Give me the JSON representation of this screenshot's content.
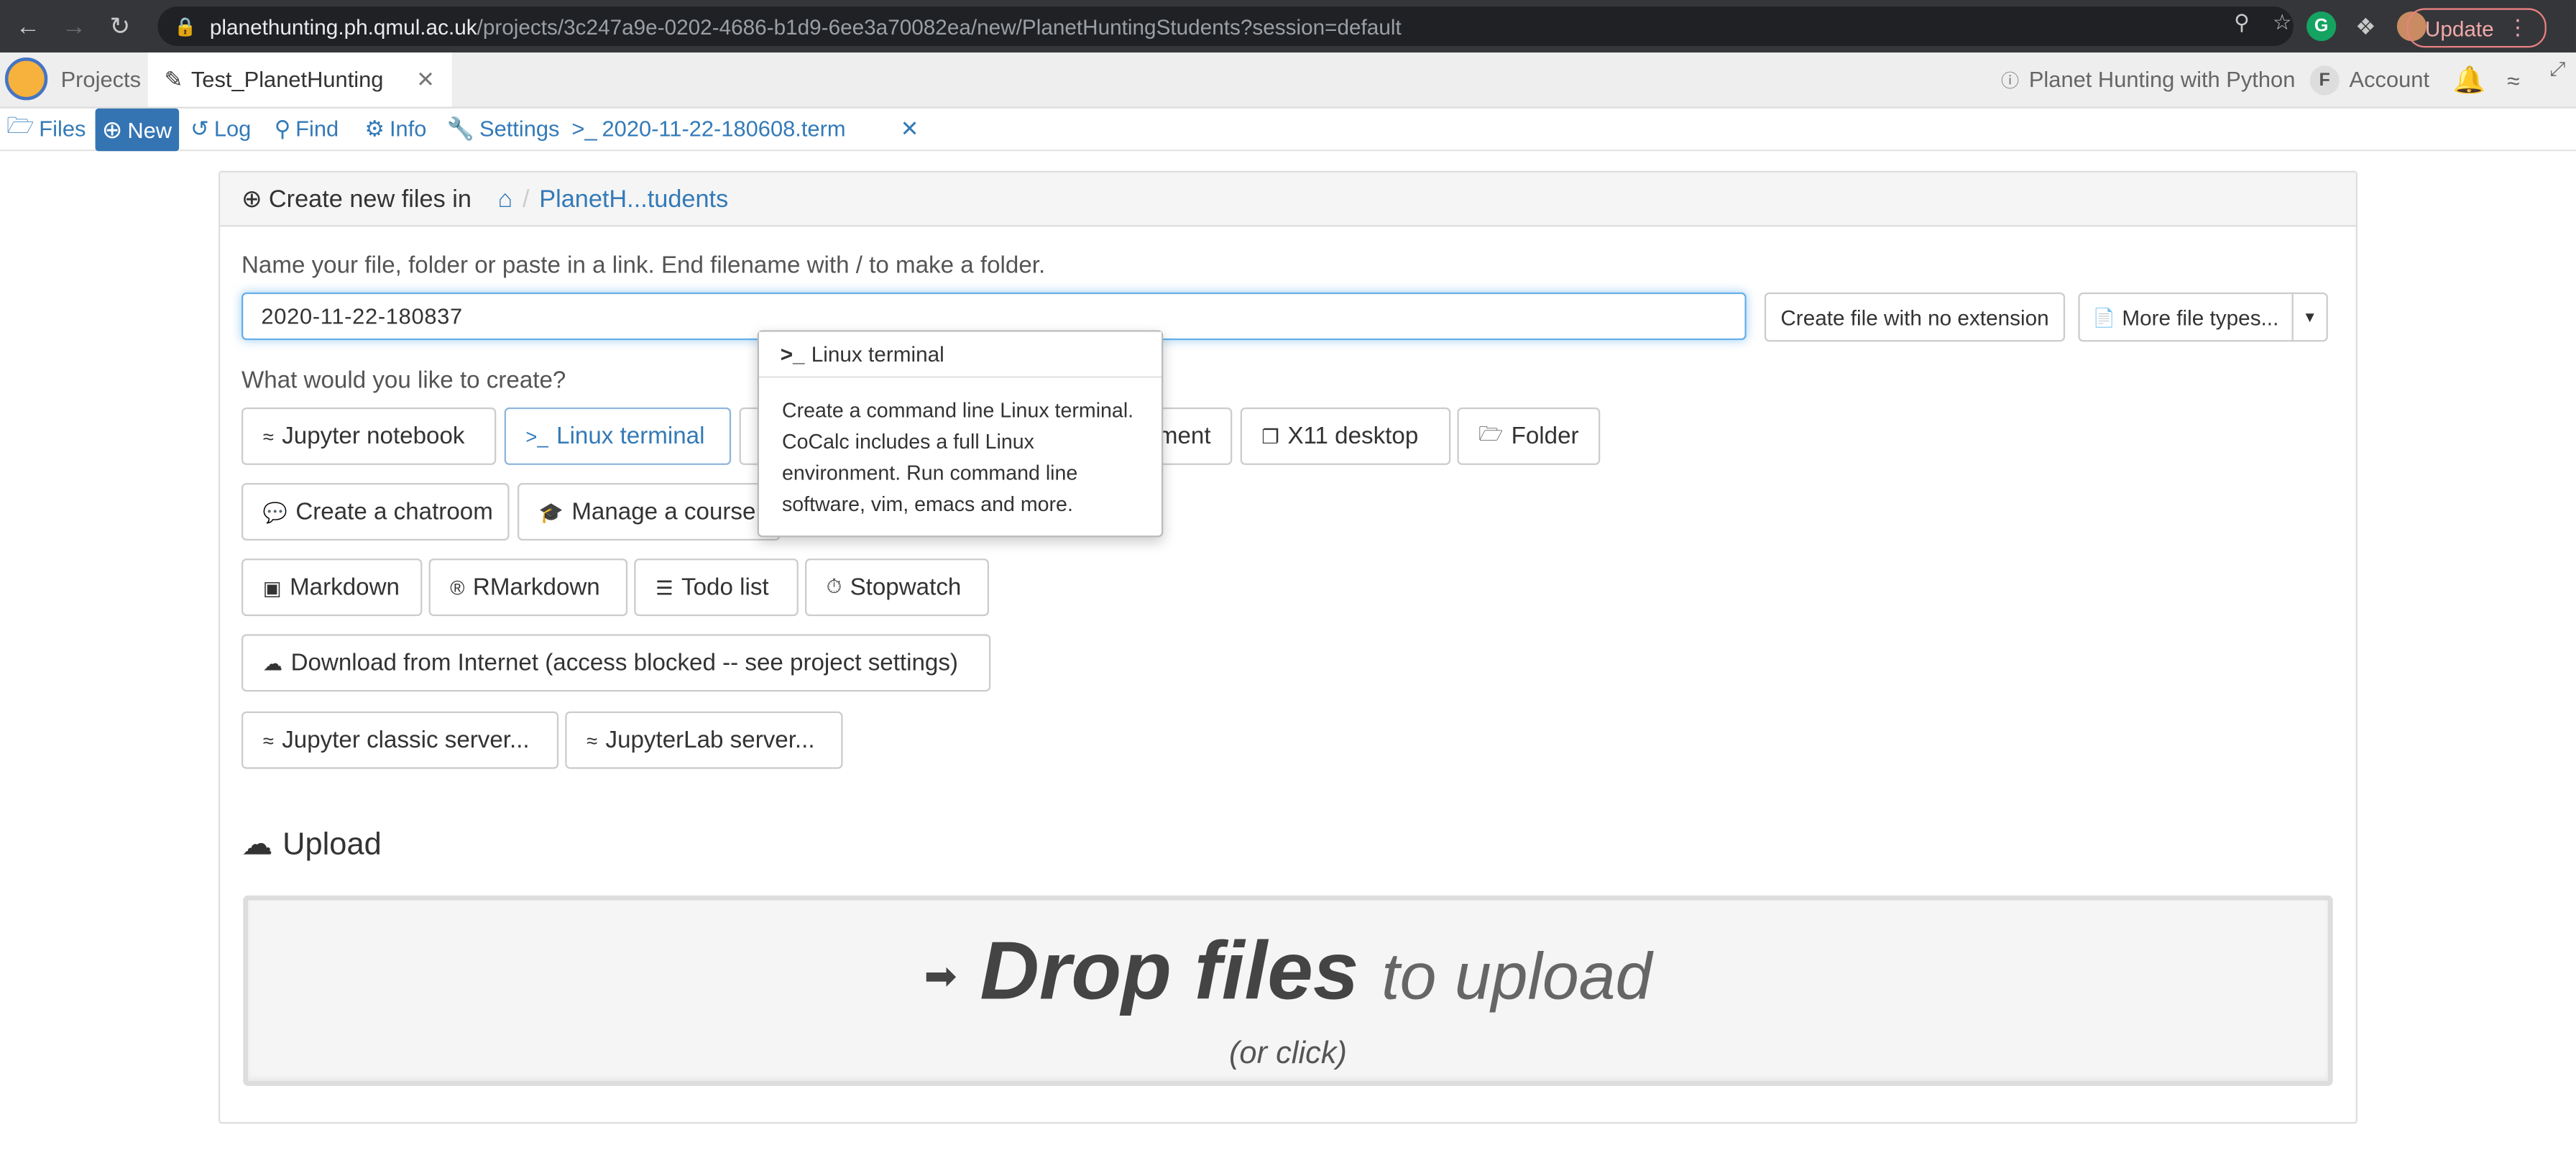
{
  "browser": {
    "url_host": "planethunting.ph.qmul.ac.uk",
    "url_path": "/projects/3c247a9e-0202-4686-b1d9-6ee3a70082ea/new/PlanetHuntingStudents?session=default",
    "update_label": "Update",
    "ext_g": "G"
  },
  "tabs": {
    "projects": "Projects",
    "active": "Test_PlanetHunting",
    "course": "Planet Hunting with Python",
    "account_initial": "F",
    "account": "Account"
  },
  "actions": {
    "files": "Files",
    "new": "New",
    "log": "Log",
    "find": "Find",
    "info": "Info",
    "settings": "Settings",
    "term_tab": "2020-11-22-180608.term"
  },
  "panel": {
    "title": "Create new files in",
    "crumb": "PlanetH...tudents",
    "name_label": "Name your file, folder or paste in a link. End filename with / to make a folder.",
    "filename_value": "2020-11-22-180837",
    "no_ext_btn": "Create file with no extension",
    "more_types_btn": "More file types...",
    "what_label": "What would you like to create?",
    "buttons": {
      "jupyter": "Jupyter notebook",
      "linux": "Linux terminal",
      "latex_partial": "ment",
      "x11": "X11 desktop",
      "folder": "Folder",
      "chatroom": "Create a chatroom",
      "course": "Manage a course",
      "markdown": "Markdown",
      "rmarkdown": "RMarkdown",
      "todo": "Todo list",
      "stopwatch": "Stopwatch",
      "download": "Download from Internet (access blocked -- see project settings)",
      "jclassic": "Jupyter classic server...",
      "jlab": "JupyterLab server..."
    },
    "tooltip": {
      "title": "Linux terminal",
      "body": "Create a command line Linux terminal. CoCalc includes a full Linux environment. Run command line software, vim, emacs and more."
    },
    "upload": {
      "title": "Upload",
      "drop_bold": "Drop files",
      "drop_light": "to upload",
      "drop_sub": "(or click)"
    }
  },
  "colors": {
    "accent": "#337ab7",
    "chrome": "#35363a",
    "tabbar": "#eeeeee"
  }
}
